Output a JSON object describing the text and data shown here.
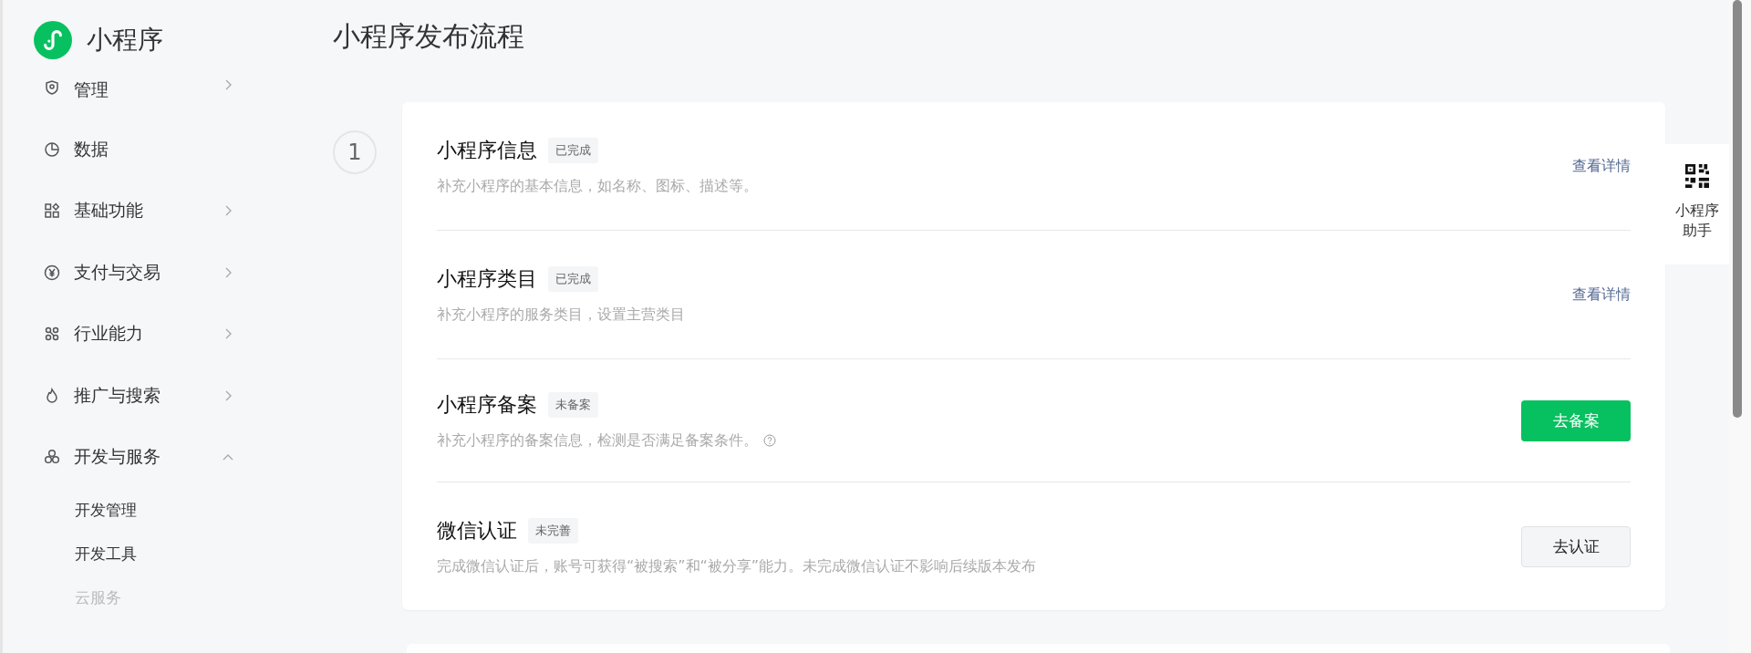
{
  "app": {
    "title": "小程序"
  },
  "sidebar": {
    "items": [
      {
        "label": "管理",
        "expanded": false
      },
      {
        "label": "数据"
      },
      {
        "label": "基础功能",
        "expanded": false
      },
      {
        "label": "支付与交易",
        "expanded": false
      },
      {
        "label": "行业能力",
        "expanded": false
      },
      {
        "label": "推广与搜索",
        "expanded": false
      },
      {
        "label": "开发与服务",
        "expanded": true,
        "children": [
          {
            "label": "开发管理",
            "disabled": false
          },
          {
            "label": "开发工具",
            "disabled": false
          },
          {
            "label": "云服务",
            "disabled": true
          }
        ]
      }
    ]
  },
  "page": {
    "title": "小程序发布流程"
  },
  "step": {
    "number": "1",
    "rows": [
      {
        "title": "小程序信息",
        "status": "已完成",
        "description": "补充小程序的基本信息，如名称、图标、描述等。",
        "action": {
          "kind": "link",
          "label": "查看详情"
        }
      },
      {
        "title": "小程序类目",
        "status": "已完成",
        "description": "补充小程序的服务类目，设置主营类目",
        "action": {
          "kind": "link",
          "label": "查看详情"
        }
      },
      {
        "title": "小程序备案",
        "status": "未备案",
        "description": "补充小程序的备案信息，检测是否满足备案条件。",
        "help": true,
        "action": {
          "kind": "primary",
          "label": "去备案"
        }
      },
      {
        "title": "微信认证",
        "status": "未完善",
        "description": "完成微信认证后，账号可获得“被搜索”和“被分享”能力。未完成微信认证不影响后续版本发布",
        "action": {
          "kind": "secondary",
          "label": "去认证"
        }
      }
    ]
  },
  "assistant": {
    "label": "小程序助手"
  }
}
